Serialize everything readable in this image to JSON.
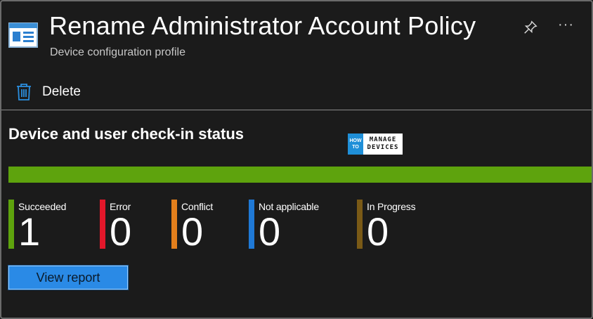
{
  "header": {
    "title": "Rename Administrator Account Policy",
    "subtitle": "Device configuration profile",
    "icons": {
      "app": "profile-document-icon",
      "pin": "pin-icon",
      "more": "more-icon"
    },
    "more_glyph": "···"
  },
  "toolbar": {
    "delete_label": "Delete",
    "delete_icon": "trash-icon"
  },
  "status_section": {
    "title": "Device and user check-in status",
    "watermark": {
      "small_top": "HOW",
      "small_bottom": "TO",
      "big_top": "MANAGE",
      "big_bottom": "DEVICES"
    },
    "progress": {
      "succeeded_fraction": 1.0,
      "color": "#5ea30d"
    },
    "stats": [
      {
        "label": "Succeeded",
        "value": "1",
        "color": "#5ea30d"
      },
      {
        "label": "Error",
        "value": "0",
        "color": "#e3172a"
      },
      {
        "label": "Conflict",
        "value": "0",
        "color": "#e37f1c"
      },
      {
        "label": "Not applicable",
        "value": "0",
        "color": "#1f79d6"
      },
      {
        "label": "In Progress",
        "value": "0",
        "color": "#7a5a16"
      }
    ],
    "view_report_label": "View report"
  },
  "colors": {
    "background": "#1b1b1b",
    "accent": "#2a8ae6",
    "icon_blue": "#2b8fe0"
  }
}
